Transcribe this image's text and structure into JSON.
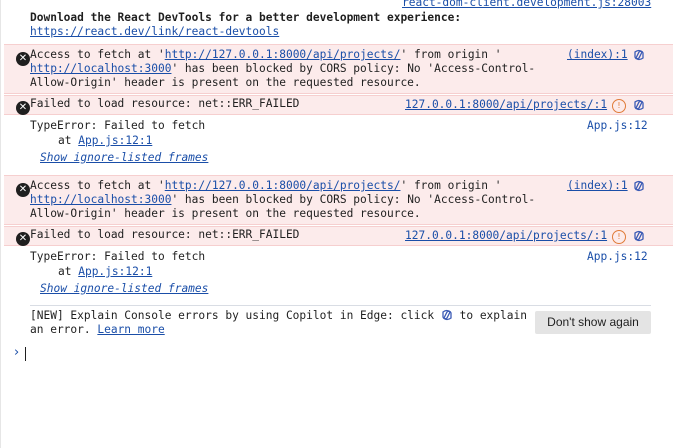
{
  "top": {
    "source": "react-dom-client.development.js:28003",
    "devtools_msg": "Download the React DevTools for a better development experience:",
    "devtools_link": "https://react.dev/link/react-devtools"
  },
  "cors1": {
    "pre": "Access to fetch at '",
    "url": "http://127.0.0.1:8000/api/projects/",
    "mid": "' from origin '",
    "origin": "http://localhost:3000",
    "post1": "' has been blocked by CORS policy: No 'Access-Control-",
    "post2": "Allow-Origin' header is present on the requested resource.",
    "source": "(index):1"
  },
  "fail1": {
    "text": "Failed to load resource: net::ERR_FAILED",
    "source": "127.0.0.1:8000/api/projects/:1"
  },
  "type1": {
    "text": "TypeError: Failed to fetch",
    "at": "at ",
    "at_link": "App.js:12:1",
    "ignore": "Show ignore-listed frames",
    "source": "App.js:12"
  },
  "cors2": {
    "pre": "Access to fetch at '",
    "url": "http://127.0.0.1:8000/api/projects/",
    "mid": "' from origin '",
    "origin": "http://localhost:3000",
    "post1": "' has been blocked by CORS policy: No 'Access-Control-",
    "post2": "Allow-Origin' header is present on the requested resource.",
    "source": "(index):1"
  },
  "fail2": {
    "text": "Failed to load resource: net::ERR_FAILED",
    "source": "127.0.0.1:8000/api/projects/:1"
  },
  "type2": {
    "text": "TypeError: Failed to fetch",
    "at": "at ",
    "at_link": "App.js:12:1",
    "ignore": "Show ignore-listed frames",
    "source": "App.js:12"
  },
  "banner": {
    "line1_pre": "[NEW] Explain Console errors by using Copilot in Edge: click ",
    "line1_post": " to explain",
    "line2_pre": "an error. ",
    "learn_more": "Learn more",
    "dont_show": "Don't show again"
  },
  "prompt_symbol": "›",
  "colors": {
    "error_bg": "#fcebeb",
    "link": "#1a4ea8",
    "warn": "#e07b39"
  },
  "icons": {
    "error": "error-circle-icon",
    "copilot": "copilot-icon",
    "warning": "warning-icon"
  }
}
